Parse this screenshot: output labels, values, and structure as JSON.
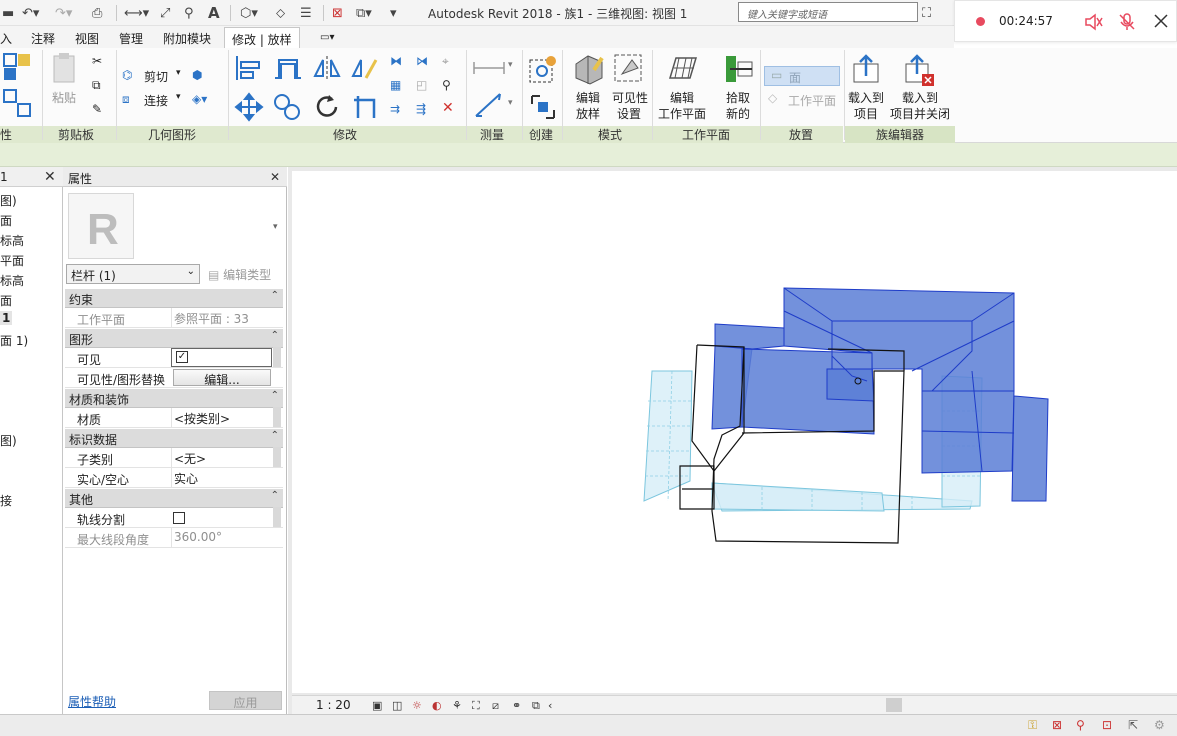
{
  "window": {
    "title": "Autodesk Revit 2018 -   族1 - 三维视图: 视图 1",
    "search_placeholder": "键入关键字或短语"
  },
  "recorder": {
    "time": "00:24:57"
  },
  "tabs": [
    {
      "label": "入"
    },
    {
      "label": "注释"
    },
    {
      "label": "视图"
    },
    {
      "label": "管理"
    },
    {
      "label": "附加模块"
    },
    {
      "label": "修改 | 放样"
    }
  ],
  "ribbon": {
    "groups": {
      "properties": "性",
      "clipboard": "剪贴板",
      "geometry": "几何图形",
      "modify": "修改",
      "measure": "测量",
      "create": "创建",
      "mode": "模式",
      "workplane": "工作平面",
      "place": "放置",
      "family_editor": "族编辑器"
    },
    "buttons": {
      "paste": "粘贴",
      "cut": "剪切",
      "join": "连接",
      "edit_sweep_1": "编辑",
      "edit_sweep_2": "放样",
      "visibility_1": "可见性",
      "visibility_2": "设置",
      "edit_wp_1": "编辑",
      "edit_wp_2": "工作平面",
      "pick_1": "拾取",
      "pick_2": "新的",
      "face": "面",
      "on_workplane": "工作平面",
      "load_1": "载入到",
      "load_2": "项目",
      "load_close_1": "载入到",
      "load_close_2": "项目并关闭"
    }
  },
  "browser": {
    "title": "1",
    "items": [
      "图)",
      "面",
      "标高",
      "平面",
      "标高",
      "面",
      "1",
      "面 1)",
      "图)",
      "接"
    ]
  },
  "properties": {
    "title": "属性",
    "type_name": "栏杆 (1)",
    "edit_type": "编辑类型",
    "sections": {
      "constraints": "约束",
      "graphics": "图形",
      "materials": "材质和装饰",
      "identity": "标识数据",
      "other": "其他"
    },
    "rows": {
      "work_plane_label": "工作平面",
      "work_plane_value": "参照平面 : 33",
      "visible_label": "可见",
      "visibility_override_label": "可见性/图形替换",
      "visibility_override_button": "编辑...",
      "material_label": "材质",
      "material_value": "<按类别>",
      "subcategory_label": "子类别",
      "subcategory_value": "<无>",
      "solid_void_label": "实心/空心",
      "solid_void_value": "实心",
      "trajectory_label": "轨线分割",
      "max_segment_label": "最大线段角度",
      "max_segment_value": "360.00°"
    },
    "help": "属性帮助",
    "apply": "应用"
  },
  "viewbar": {
    "scale": "1 : 20"
  },
  "colors": {
    "accent_blue": "#2b73c6",
    "model_blue": "#5b7ed6",
    "model_edge": "#1e3cc8",
    "ghost_fill": "#d6eef8",
    "ghost_edge": "#7cc6de"
  }
}
